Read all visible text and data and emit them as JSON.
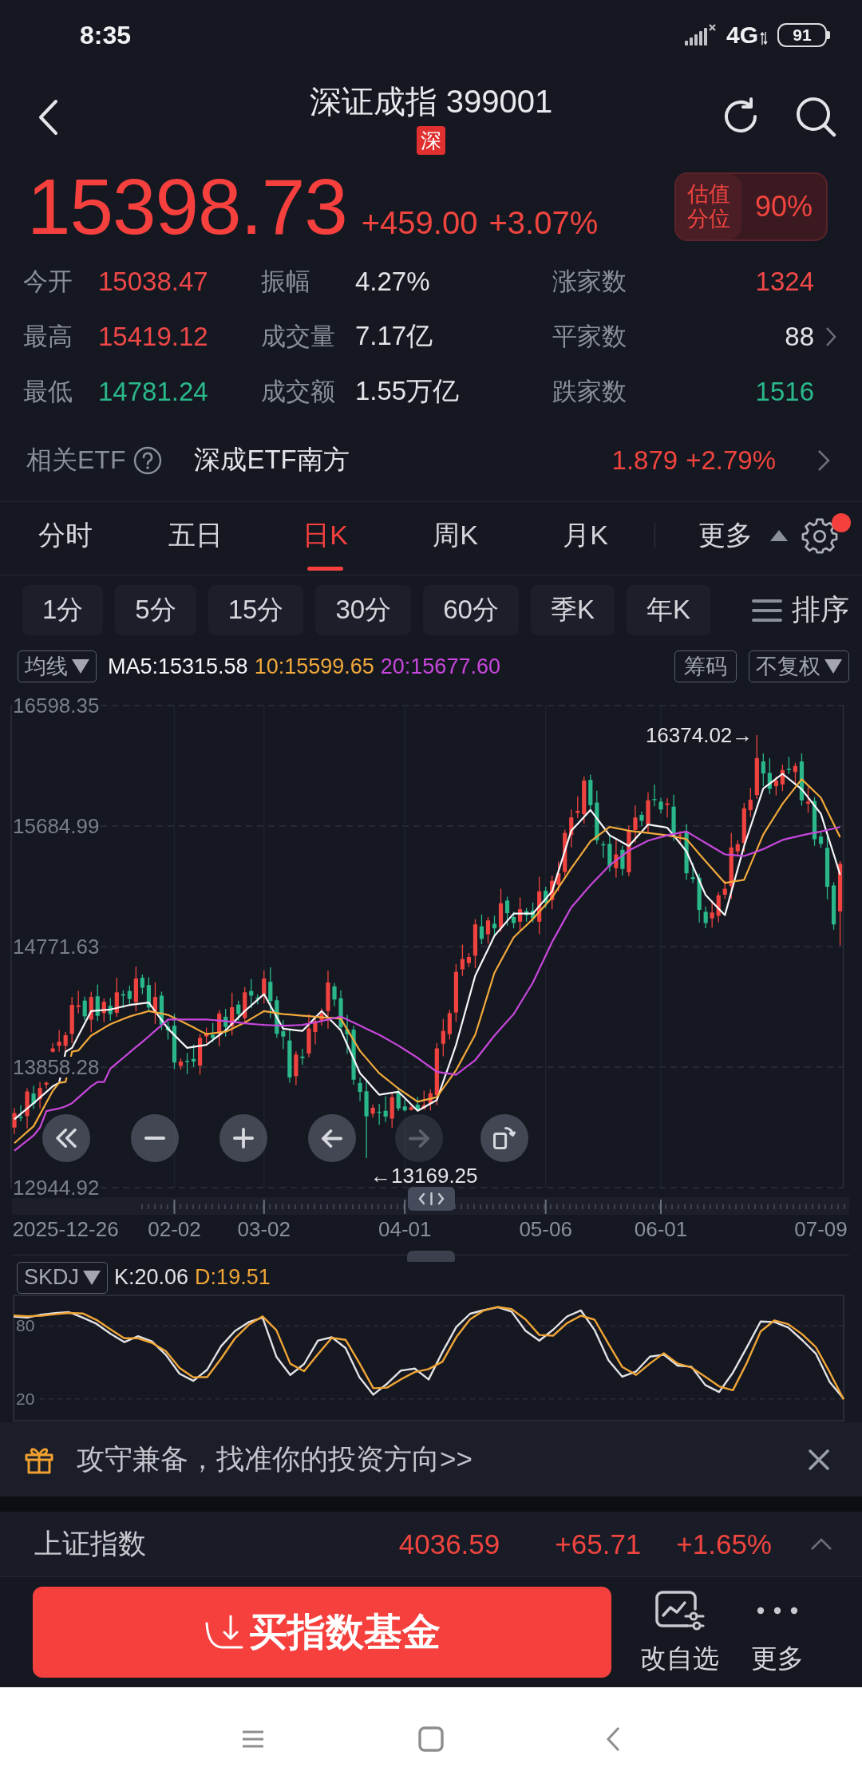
{
  "status_bar": {
    "time": "8:35",
    "network": "4G",
    "battery": "91"
  },
  "header": {
    "title": "深证成指 399001",
    "exchange_badge": "深"
  },
  "quote": {
    "price": "15398.73",
    "change": "+459.00",
    "change_percent": "+3.07%",
    "valuation": {
      "label": "估值分位",
      "value": "90%"
    }
  },
  "stats": [
    {
      "label": "今开",
      "value": "15038.47",
      "color": "#f04848",
      "chevron": false
    },
    {
      "label": "振幅",
      "value": "4.27%",
      "color": "#e4e5e8",
      "chevron": false
    },
    {
      "label": "涨家数",
      "value": "1324",
      "color": "#f04848",
      "chevron": false
    },
    {
      "label": "最高",
      "value": "15419.12",
      "color": "#f04848",
      "chevron": false
    },
    {
      "label": "成交量",
      "value": "7.17亿",
      "color": "#e4e5e8",
      "chevron": false
    },
    {
      "label": "平家数",
      "value": "88",
      "color": "#e4e5e8",
      "chevron": true
    },
    {
      "label": "最低",
      "value": "14781.24",
      "color": "#2bb88a",
      "chevron": false
    },
    {
      "label": "成交额",
      "value": "1.55万亿",
      "color": "#e4e5e8",
      "chevron": false
    },
    {
      "label": "跌家数",
      "value": "1516",
      "color": "#2bb88a",
      "chevron": false
    }
  ],
  "related_etf": {
    "label": "相关ETF",
    "name": "深成ETF南方",
    "price": "1.879",
    "change": "+2.79%"
  },
  "period_bar": {
    "tabs": [
      {
        "label": "分时",
        "selected": false
      },
      {
        "label": "五日",
        "selected": false
      },
      {
        "label": "日K",
        "selected": true
      },
      {
        "label": "周K",
        "selected": false
      },
      {
        "label": "月K",
        "selected": false
      }
    ],
    "more": "更多",
    "settings_notification": true
  },
  "intervals": [
    {
      "label": "1分",
      "selected": false
    },
    {
      "label": "5分",
      "selected": false
    },
    {
      "label": "15分",
      "selected": false
    },
    {
      "label": "30分",
      "selected": false
    },
    {
      "label": "60分",
      "selected": false
    },
    {
      "label": "季K",
      "selected": false
    },
    {
      "label": "年K",
      "selected": false
    }
  ],
  "sort": "排序",
  "chart": {
    "indicator": "均线",
    "chip": "筹码",
    "adjust": "不复权",
    "annotations": [
      {
        "kind": "high",
        "text": "16374.02→"
      },
      {
        "kind": "low",
        "text": "←13169.25"
      }
    ],
    "controls": [
      {
        "kind": "rewind",
        "disabled": false
      },
      {
        "kind": "zoom_out",
        "disabled": false
      },
      {
        "kind": "zoom_in",
        "disabled": false
      },
      {
        "kind": "back",
        "disabled": false
      },
      {
        "kind": "forward",
        "disabled": true
      },
      {
        "kind": "rotate",
        "disabled": false
      }
    ],
    "chart_data": {
      "type": "candlestick",
      "grid": true,
      "categories": [
        null,
        null,
        null,
        null,
        null,
        null,
        null,
        null,
        "2025-12-26",
        null,
        null,
        null,
        null,
        null,
        null,
        null,
        null,
        null,
        null,
        null,
        null,
        null,
        null,
        null,
        null,
        "02-02",
        null,
        null,
        null,
        null,
        null,
        null,
        null,
        null,
        null,
        null,
        null,
        null,
        null,
        "03-02",
        null,
        null,
        null,
        null,
        null,
        null,
        null,
        null,
        null,
        null,
        null,
        null,
        null,
        null,
        null,
        null,
        null,
        null,
        null,
        null,
        null,
        "04-01",
        null,
        null,
        null,
        null,
        null,
        null,
        null,
        null,
        null,
        null,
        null,
        null,
        null,
        null,
        null,
        null,
        null,
        null,
        null,
        null,
        null,
        "05-06",
        null,
        null,
        null,
        null,
        null,
        null,
        null,
        null,
        null,
        null,
        null,
        null,
        null,
        null,
        null,
        null,
        null,
        "06-01",
        null,
        null,
        null,
        null,
        null,
        null,
        null,
        null,
        null,
        null,
        null,
        null,
        null,
        null,
        null,
        null,
        null,
        null,
        null,
        null,
        null,
        null,
        null,
        null,
        "07-09",
        null,
        null,
        null
      ],
      "ylim": [
        12944.92,
        16598.35
      ],
      "yticks": [
        {
          "value": 16598.35,
          "label": "16598.35"
        },
        {
          "value": 15684.99,
          "label": "15684.99"
        },
        {
          "value": 14771.63,
          "label": "14771.63"
        },
        {
          "value": 13858.28,
          "label": "13858.28"
        },
        {
          "value": 12944.92,
          "label": "12944.92"
        }
      ],
      "ohlc": [
        [
          13400,
          13550,
          13350,
          13510
        ],
        [
          13480,
          13570,
          13447,
          13477
        ],
        [
          13487,
          13698,
          13392,
          13673
        ],
        [
          13658,
          13718,
          13540,
          13580
        ],
        [
          13615,
          13745,
          13545,
          13700
        ],
        [
          13725,
          13750,
          13695,
          13740
        ],
        [
          13975,
          14040,
          13968,
          14000
        ],
        [
          14020,
          14140,
          13975,
          14050
        ],
        [
          14020,
          14125,
          13980,
          14100
        ],
        [
          14110,
          14390,
          14040,
          14330
        ],
        [
          14315,
          14437,
          14265,
          14327
        ],
        [
          14362,
          14392,
          14213,
          14243
        ],
        [
          14218,
          14430,
          14123,
          14390
        ],
        [
          14395,
          14485,
          14207,
          14247
        ],
        [
          14267,
          14378,
          14197,
          14353
        ],
        [
          14323,
          14383,
          14210,
          14260
        ],
        [
          14270,
          14535,
          14240,
          14425
        ],
        [
          14410,
          14440,
          14305,
          14400
        ],
        [
          14435,
          14475,
          14335,
          14375
        ],
        [
          14350,
          14620,
          14280,
          14530
        ],
        [
          14535,
          14560,
          14410,
          14460
        ],
        [
          14480,
          14540,
          14280,
          14310
        ],
        [
          14280,
          14500,
          14185,
          14390
        ],
        [
          14400,
          14430,
          14140,
          14180
        ],
        [
          14165,
          14205,
          14067,
          14137
        ],
        [
          14172,
          14262,
          13843,
          13893
        ],
        [
          13868,
          13925,
          13838,
          13900
        ],
        [
          13905,
          13965,
          13805,
          13900
        ],
        [
          13920,
          14030,
          13860,
          13900
        ],
        [
          13870,
          14110,
          13800,
          14080
        ],
        [
          14090,
          14158,
          14040,
          14118
        ],
        [
          14103,
          14193,
          14047,
          14077
        ],
        [
          14112,
          14290,
          14017,
          14265
        ],
        [
          14240,
          14300,
          14090,
          14163
        ],
        [
          14168,
          14422,
          14098,
          14312
        ],
        [
          14332,
          14362,
          14210,
          14260
        ],
        [
          14230,
          14465,
          14200,
          14425
        ],
        [
          14435,
          14525,
          14305,
          14400
        ],
        [
          14385,
          14410,
          14335,
          14375
        ],
        [
          14410,
          14590,
          14340,
          14530
        ],
        [
          14505,
          14615,
          14230,
          14360
        ],
        [
          14365,
          14395,
          14080,
          14110
        ],
        [
          14130,
          14215,
          13995,
          14090
        ],
        [
          14060,
          14150,
          13740,
          13780
        ],
        [
          13790,
          13978,
          13720,
          13953
        ],
        [
          13938,
          13998,
          13877,
          13927
        ],
        [
          13962,
          14260,
          13932,
          14150
        ],
        [
          14125,
          14237,
          14030,
          14207
        ],
        [
          14212,
          14303,
          14172,
          14263
        ],
        [
          14283,
          14590,
          14150,
          14500
        ],
        [
          14470,
          14495,
          14320,
          14370
        ],
        [
          14380,
          14440,
          14130,
          14160
        ],
        [
          14145,
          14255,
          13960,
          14107
        ],
        [
          14142,
          14172,
          13723,
          13763
        ],
        [
          13738,
          13778,
          13600,
          13670
        ],
        [
          13675,
          13765,
          13169.25,
          13485
        ],
        [
          13505,
          13575,
          13475,
          13550
        ],
        [
          13520,
          13580,
          13422,
          13517
        ],
        [
          13527,
          13637,
          13443,
          13483
        ],
        [
          13468,
          13660,
          13398,
          13630
        ],
        [
          13665,
          13705,
          13525,
          13545
        ],
        [
          13560,
          13610,
          13522,
          13530
        ],
        [
          13535,
          13578,
          13528,
          13553
        ],
        [
          13573,
          13633,
          13530,
          13540
        ],
        [
          13545,
          13680,
          13535,
          13570
        ],
        [
          13580,
          13690,
          13530,
          13660
        ],
        [
          13645,
          14040,
          13570,
          14000
        ],
        [
          14035,
          14223,
          13940,
          14133
        ],
        [
          14108,
          14292,
          14068,
          14267
        ],
        [
          14272,
          14640,
          14202,
          14580
        ],
        [
          14600,
          14787,
          14550,
          14677
        ],
        [
          14647,
          14723,
          14617,
          14693
        ],
        [
          14703,
          14980,
          14608,
          14940
        ],
        [
          14925,
          15015,
          14790,
          14830
        ],
        [
          14865,
          14995,
          14795,
          14970
        ],
        [
          14945,
          15005,
          14860,
          14910
        ],
        [
          14915,
          15210,
          14885,
          15100
        ],
        [
          15120,
          15150,
          14930,
          15025
        ],
        [
          14995,
          15035,
          14910,
          14950
        ],
        [
          14960,
          15145,
          14890,
          15055
        ],
        [
          15040,
          15065,
          14960,
          15010
        ],
        [
          15045,
          15105,
          14955,
          14985
        ],
        [
          14960,
          15300,
          14865,
          15190
        ],
        [
          15195,
          15225,
          15065,
          15105
        ],
        [
          15125,
          15310,
          15055,
          15270
        ],
        [
          15240,
          15417,
          15190,
          15327
        ],
        [
          15337,
          15658,
          15307,
          15633
        ],
        [
          15618,
          15810,
          15523,
          15750
        ],
        [
          15785,
          15910,
          15745,
          15800
        ],
        [
          15775,
          16060,
          15705,
          16030
        ],
        [
          16035,
          16075,
          15793,
          15843
        ],
        [
          15863,
          15953,
          15547,
          15577
        ],
        [
          15547,
          15572,
          15445,
          15540
        ],
        [
          15550,
          15610,
          15340,
          15380
        ],
        [
          15365,
          15580,
          15295,
          15470
        ],
        [
          15505,
          15535,
          15310,
          15360
        ],
        [
          15335,
          15690,
          15305,
          15650
        ],
        [
          15655,
          15840,
          15560,
          15750
        ],
        [
          15770,
          15795,
          15685,
          15725
        ],
        [
          15695,
          15940,
          15625,
          15880
        ],
        [
          15890,
          16000,
          15835,
          15885
        ],
        [
          15870,
          15900,
          15780,
          15810
        ],
        [
          15845,
          15897,
          15750,
          15857
        ],
        [
          15832,
          15922,
          15573,
          15613
        ],
        [
          15618,
          15645,
          15548,
          15620
        ],
        [
          15640,
          15700,
          15277,
          15327
        ],
        [
          15297,
          15407,
          15253,
          15283
        ],
        [
          15293,
          15323,
          14955,
          15050
        ],
        [
          15035,
          15075,
          14910,
          14950
        ],
        [
          14985,
          15120,
          14915,
          15030
        ],
        [
          15005,
          15185,
          14955,
          15160
        ],
        [
          15165,
          15270,
          15135,
          15210
        ],
        [
          15230,
          15633,
          15135,
          15523
        ],
        [
          15493,
          15577,
          15453,
          15547
        ],
        [
          15557,
          15860,
          15487,
          15820
        ],
        [
          15805,
          15975,
          15755,
          15885
        ],
        [
          15920,
          16374.02,
          15890,
          16200
        ],
        [
          16175,
          16235,
          15988,
          16083
        ],
        [
          16088,
          16198,
          15927,
          15967
        ],
        [
          15987,
          16060,
          15917,
          16030
        ],
        [
          16000,
          16150,
          15950,
          16110
        ],
        [
          16120,
          16210,
          16080,
          16110
        ],
        [
          16095,
          16165,
          16000,
          16140
        ],
        [
          16175,
          16235,
          15840,
          15880
        ],
        [
          15855,
          15980,
          15785,
          15870
        ],
        [
          15875,
          15905,
          15535,
          15585
        ],
        [
          15605,
          15645,
          15520,
          15550
        ],
        [
          15520,
          15610,
          15130,
          15225
        ],
        [
          15235,
          15260,
          14900,
          14940
        ],
        [
          15038.47,
          15419.12,
          14781.24,
          15398.73
        ]
      ],
      "series": [
        {
          "type": "line",
          "name": "MA5:15315.58",
          "color": "#f6f6f8",
          "values": [
            13463,
            13504,
            13544,
            13585,
            13628,
            13670,
            13713,
            13740,
            13975,
            14004,
            14097,
            14190,
            14283,
            14287,
            14291,
            14295,
            14306,
            14318,
            14329,
            14335,
            14341,
            14347,
            14281,
            14215,
            14149,
            14101,
            14052,
            14004,
            14012,
            14019,
            14027,
            14064,
            14100,
            14137,
            14186,
            14234,
            14283,
            14326,
            14368,
            14411,
            14324,
            14236,
            14149,
            14143,
            14138,
            14132,
            14182,
            14233,
            14283,
            14234,
            14186,
            14137,
            14029,
            13920,
            13812,
            13758,
            13703,
            13649,
            13657,
            13664,
            13672,
            13624,
            13575,
            13527,
            13554,
            13581,
            13608,
            13748,
            13887,
            14027,
            14202,
            14376,
            14551,
            14652,
            14752,
            14853,
            14909,
            14966,
            15022,
            15022,
            15022,
            15022,
            15078,
            15134,
            15190,
            15343,
            15497,
            15650,
            15702,
            15755,
            15807,
            15743,
            15679,
            15615,
            15588,
            15561,
            15534,
            15588,
            15643,
            15697,
            15689,
            15681,
            15673,
            15613,
            15553,
            15493,
            15382,
            15272,
            15161,
            15111,
            15060,
            15010,
            15185,
            15359,
            15534,
            15679,
            15825,
            15970,
            16007,
            16044,
            16081,
            16042,
            16003,
            15964,
            15902,
            15840,
            15778,
            15624,
            15470,
            15316
          ]
        },
        {
          "type": "line",
          "name": "10:15599.65",
          "color": "#f2a93b",
          "values": [
            13282,
            13325,
            13367,
            13410,
            13499,
            13589,
            13678,
            13740,
            13745,
            13975,
            13984,
            14041,
            14097,
            14126,
            14155,
            14184,
            14203,
            14223,
            14242,
            14256,
            14269,
            14283,
            14273,
            14264,
            14254,
            14231,
            14207,
            14184,
            14159,
            14133,
            14108,
            14114,
            14120,
            14126,
            14149,
            14173,
            14196,
            14225,
            14254,
            14283,
            14275,
            14268,
            14260,
            14256,
            14252,
            14248,
            14244,
            14240,
            14236,
            14232,
            14229,
            14225,
            14143,
            14062,
            13980,
            13924,
            13868,
            13812,
            13773,
            13734,
            13695,
            13662,
            13629,
            13596,
            13608,
            13619,
            13631,
            13699,
            13767,
            13835,
            13924,
            14014,
            14103,
            14260,
            14417,
            14574,
            14663,
            14752,
            14841,
            14888,
            14934,
            14981,
            15035,
            15090,
            15144,
            15218,
            15291,
            15365,
            15433,
            15501,
            15569,
            15606,
            15642,
            15679,
            15669,
            15660,
            15650,
            15644,
            15639,
            15633,
            15627,
            15621,
            15615,
            15605,
            15596,
            15586,
            15530,
            15473,
            15417,
            15363,
            15308,
            15254,
            15262,
            15270,
            15278,
            15392,
            15507,
            15621,
            15699,
            15776,
            15854,
            15916,
            15978,
            16040,
            15993,
            15947,
            15900,
            15800,
            15700,
            15600
          ]
        },
        {
          "type": "line",
          "name": "20:15677.60",
          "color": "#c847dc",
          "values": [
            13224,
            13263,
            13301,
            13340,
            13400,
            13525,
            13535,
            13545,
            13560,
            13585,
            13628,
            13670,
            13713,
            13745,
            13745,
            13847,
            13888,
            13928,
            13969,
            14010,
            14050,
            14091,
            14134,
            14176,
            14219,
            14219,
            14219,
            14219,
            14219,
            14219,
            14219,
            14215,
            14211,
            14207,
            14201,
            14196,
            14190,
            14186,
            14182,
            14178,
            14176,
            14174,
            14172,
            14174,
            14176,
            14178,
            14188,
            14197,
            14207,
            14219,
            14230,
            14242,
            14219,
            14195,
            14172,
            14149,
            14126,
            14103,
            14076,
            14048,
            14021,
            13990,
            13959,
            13928,
            13893,
            13858,
            13823,
            13815,
            13808,
            13800,
            13837,
            13874,
            13911,
            13973,
            14035,
            14097,
            14151,
            14206,
            14260,
            14339,
            14419,
            14498,
            14601,
            14703,
            14806,
            14893,
            14981,
            15068,
            15124,
            15181,
            15237,
            15287,
            15338,
            15388,
            15425,
            15462,
            15499,
            15524,
            15549,
            15574,
            15588,
            15601,
            15615,
            15625,
            15634,
            15644,
            15615,
            15586,
            15557,
            15528,
            15499,
            15470,
            15466,
            15462,
            15458,
            15475,
            15493,
            15510,
            15533,
            15557,
            15580,
            15592,
            15603,
            15615,
            15625,
            15634,
            15644,
            15655,
            15667,
            15678
          ]
        }
      ]
    }
  },
  "skdj": {
    "indicator": "SKDJ",
    "chart_data": {
      "type": "line",
      "ylim": [
        2,
        105
      ],
      "yticks": [
        80,
        20
      ],
      "series": [
        {
          "name": "K:20.06",
          "color": "#e2e3e7",
          "values": [
            87.6,
            86.7,
            89.1,
            90.5,
            91.2,
            86.7,
            81.6,
            73.5,
            66.6,
            71.5,
            67.2,
            56.2,
            40.6,
            34.8,
            44,
            63.3,
            75.6,
            83.1,
            86.8,
            54.6,
            39.6,
            48.6,
            67.8,
            70.6,
            61.7,
            37.7,
            23.4,
            32.4,
            43.2,
            44.9,
            35.9,
            58.4,
            79,
            89.9,
            92.9,
            95.2,
            91.6,
            76,
            67.8,
            76.8,
            87.6,
            92.7,
            76.4,
            51.7,
            38.2,
            42.5,
            54.7,
            56.2,
            47.3,
            46.4,
            31.3,
            25.6,
            41.6,
            62.3,
            83.5,
            83.1,
            78.6,
            68.3,
            57,
            33.7,
            20.1
          ]
        },
        {
          "name": "D:19.51",
          "color": "#f0a536",
          "values": [
            88.5,
            87.9,
            88.3,
            89.5,
            90.6,
            90.1,
            84.8,
            77.2,
            69.7,
            69.7,
            66,
            59.3,
            45.4,
            37.6,
            37.9,
            53,
            69.6,
            80.9,
            87.7,
            76.4,
            48.9,
            42.7,
            56.6,
            70.1,
            68.5,
            49.4,
            28.7,
            29.2,
            36,
            42,
            44.4,
            50.5,
            70.7,
            85.3,
            92.7,
            95.5,
            93.7,
            85.3,
            72.5,
            71.9,
            82.1,
            88.3,
            85,
            65.2,
            46.1,
            39.7,
            49,
            57.5,
            49,
            45.7,
            38.2,
            30.2,
            27,
            49.5,
            75.3,
            84.5,
            81.3,
            73.1,
            62.4,
            41.6,
            19.5
          ]
        }
      ]
    }
  },
  "banner": {
    "text": "攻守兼备，找准你的投资方向>>"
  },
  "ticker": {
    "name": "上证指数",
    "price": "4036.59",
    "change": "+65.71",
    "change_percent": "+1.65%"
  },
  "actions": {
    "primary": "买指数基金",
    "items": [
      {
        "kind": "watchlist",
        "label": "改自选"
      },
      {
        "kind": "more",
        "label": "更多"
      }
    ]
  }
}
